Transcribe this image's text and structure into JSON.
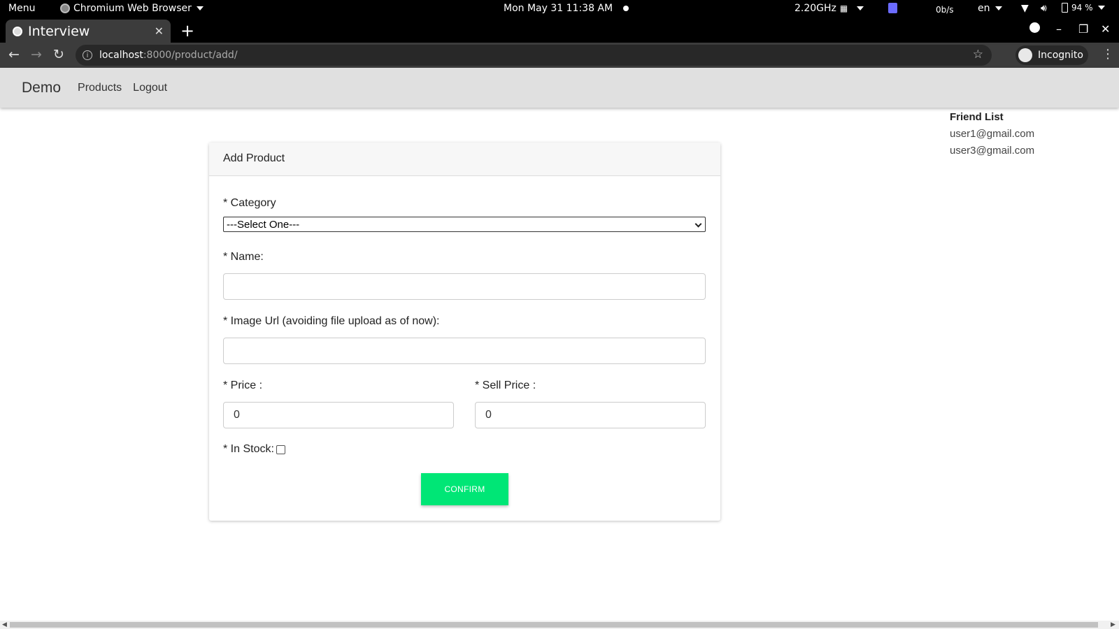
{
  "system_bar": {
    "menu": "Menu",
    "app": "Chromium Web Browser",
    "datetime": "Mon May 31  11:38 AM",
    "cpu": "2.20GHz",
    "net": "0b/s",
    "lang": "en",
    "battery": "94 %"
  },
  "browser": {
    "tab_title": "Interview",
    "url_host": "localhost",
    "url_path": ":8000/product/add/",
    "incognito_label": "Incognito"
  },
  "app_nav": {
    "brand": "Demo",
    "links": [
      "Products",
      "Logout"
    ]
  },
  "friend_list": {
    "title": "Friend List",
    "users": [
      "user1@gmail.com",
      "user3@gmail.com"
    ]
  },
  "form": {
    "header": "Add Product",
    "category_label": "* Category",
    "category_selected": "---Select One---",
    "name_label": "* Name:",
    "name_value": "",
    "image_label": "* Image Url (avoiding file upload as of now):",
    "image_value": "",
    "price_label": "* Price :",
    "price_value": "0",
    "sell_price_label": "* Sell Price :",
    "sell_price_value": "0",
    "in_stock_label": "* In Stock:",
    "in_stock_checked": false,
    "confirm_label": "CONFIRM"
  },
  "colors": {
    "confirm_button": "#00e676",
    "nav_background": "#e0e0e0"
  }
}
